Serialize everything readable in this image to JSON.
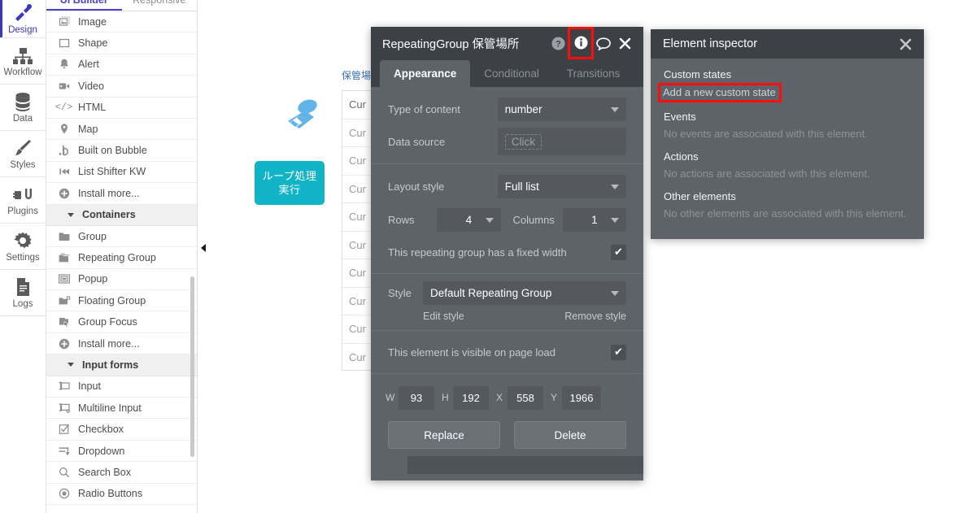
{
  "rail": {
    "items": [
      {
        "label": "Design",
        "icon": "design-tools-icon",
        "active": true
      },
      {
        "label": "Workflow",
        "icon": "workflow-hierarchy-icon",
        "active": false
      },
      {
        "label": "Data",
        "icon": "database-icon",
        "active": false
      },
      {
        "label": "Styles",
        "icon": "paintbrush-icon",
        "active": false
      },
      {
        "label": "Plugins",
        "icon": "plug-icon",
        "active": false
      },
      {
        "label": "Settings",
        "icon": "gear-icon",
        "active": false
      },
      {
        "label": "Logs",
        "icon": "document-icon",
        "active": false
      }
    ]
  },
  "palette": {
    "tabs": [
      {
        "label": "UI Builder",
        "selected": true
      },
      {
        "label": "Responsive",
        "selected": false
      }
    ],
    "items": [
      {
        "label": "Image",
        "icon": "image-icon",
        "group": false
      },
      {
        "label": "Shape",
        "icon": "square-icon",
        "group": false
      },
      {
        "label": "Alert",
        "icon": "bell-icon",
        "group": false
      },
      {
        "label": "Video",
        "icon": "video-camera-icon",
        "group": false
      },
      {
        "label": "HTML",
        "icon": "code-icon",
        "group": false
      },
      {
        "label": "Map",
        "icon": "map-pin-icon",
        "group": false
      },
      {
        "label": "Built on Bubble",
        "icon": "bubble-b-icon",
        "group": false
      },
      {
        "label": "List Shifter KW",
        "icon": "skip-back-icon",
        "group": false
      },
      {
        "label": "Install more...",
        "icon": "plus-circle-icon",
        "group": false
      },
      {
        "label": "Containers",
        "icon": "chevron-down-icon",
        "group": true
      },
      {
        "label": "Group",
        "icon": "folder-icon",
        "group": false
      },
      {
        "label": "Repeating Group",
        "icon": "folders-icon",
        "group": false
      },
      {
        "label": "Popup",
        "icon": "popup-icon",
        "group": false
      },
      {
        "label": "Floating Group",
        "icon": "floating-group-icon",
        "group": false
      },
      {
        "label": "Group Focus",
        "icon": "group-focus-icon",
        "group": false
      },
      {
        "label": "Install more...",
        "icon": "plus-circle-icon",
        "group": false
      },
      {
        "label": "Input forms",
        "icon": "chevron-down-icon",
        "group": true
      },
      {
        "label": "Input",
        "icon": "input-field-icon",
        "group": false
      },
      {
        "label": "Multiline Input",
        "icon": "multiline-input-icon",
        "group": false
      },
      {
        "label": "Checkbox",
        "icon": "checkbox-icon",
        "group": false
      },
      {
        "label": "Dropdown",
        "icon": "dropdown-icon",
        "group": false
      },
      {
        "label": "Search Box",
        "icon": "search-icon",
        "group": false
      },
      {
        "label": "Radio Buttons",
        "icon": "radio-button-icon",
        "group": false
      }
    ]
  },
  "canvas": {
    "loop_button_label": "ループ処理\n実行",
    "loop_button_color": "#11b3c6",
    "repeating_group_title": "保管場所",
    "rows": [
      "Cur",
      "Cur",
      "Cur",
      "Cur",
      "Cur",
      "Cur",
      "Cur",
      "Cur",
      "Cur",
      "Cur"
    ]
  },
  "property_editor": {
    "title": "RepeatingGroup 保管場所",
    "header_icons": [
      {
        "name": "help-icon",
        "glyph": "?"
      },
      {
        "name": "info-icon",
        "glyph": "i",
        "highlighted": true
      },
      {
        "name": "comment-icon",
        "glyph": "comment"
      },
      {
        "name": "close-icon",
        "glyph": "×"
      }
    ],
    "tabs": [
      {
        "label": "Appearance",
        "selected": true
      },
      {
        "label": "Conditional",
        "selected": false
      },
      {
        "label": "Transitions",
        "selected": false
      }
    ],
    "type_of_content": {
      "label": "Type of content",
      "value": "number"
    },
    "data_source": {
      "label": "Data source",
      "placeholder": "Click"
    },
    "layout_style": {
      "label": "Layout style",
      "value": "Full list"
    },
    "rows": {
      "label": "Rows",
      "value": "4"
    },
    "columns": {
      "label": "Columns",
      "value": "1"
    },
    "fixed_width": {
      "label": "This repeating group has a fixed width",
      "checked": true,
      "check_glyph": "✔"
    },
    "style": {
      "label": "Style",
      "value": "Default Repeating Group",
      "edit": "Edit style",
      "remove": "Remove style"
    },
    "visible_on_load": {
      "label": "This element is visible on page load",
      "checked": true,
      "check_glyph": "✔"
    },
    "geometry": {
      "w_label": "W",
      "w": "93",
      "h_label": "H",
      "h": "192",
      "x_label": "X",
      "x": "558",
      "y_label": "Y",
      "y": "1966"
    },
    "buttons": {
      "replace": "Replace",
      "delete": "Delete"
    },
    "highlight_color": "#ff0d0d"
  },
  "element_inspector": {
    "title": "Element inspector",
    "close_icon": "×",
    "sections": [
      {
        "heading": "Custom states",
        "link": "Add a new custom state",
        "link_highlighted": true,
        "empty": null
      },
      {
        "heading": "Events",
        "link": null,
        "link_highlighted": false,
        "empty": "No events are associated with this element."
      },
      {
        "heading": "Actions",
        "link": null,
        "link_highlighted": false,
        "empty": "No actions are associated with this element."
      },
      {
        "heading": "Other elements",
        "link": null,
        "link_highlighted": false,
        "empty": "No other elements are associated with this element."
      }
    ]
  }
}
